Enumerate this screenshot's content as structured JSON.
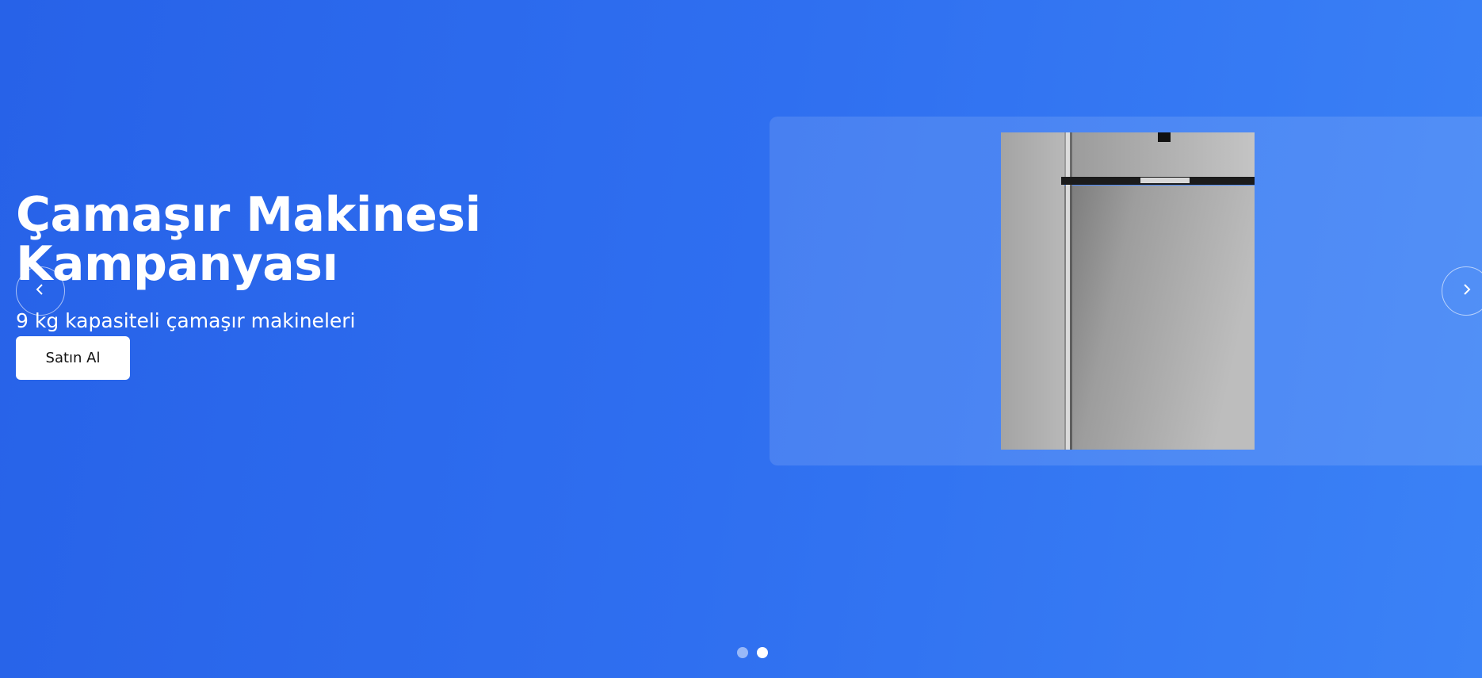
{
  "hero": {
    "title_line1": "Çamaşır Makinesi",
    "title_line2": "Kampanyası",
    "subtitle": "9 kg kapasiteli çamaşır makineleri",
    "cta_label": "Satın Al"
  },
  "carousel": {
    "prev_icon": "chevron-left-icon",
    "next_icon": "chevron-right-icon",
    "slide_count": 2,
    "active_slide": 2,
    "product_image": "refrigerator-photo"
  },
  "colors": {
    "background_start": "#2762e8",
    "background_end": "#3b82f6",
    "text": "#ffffff",
    "button_bg": "#ffffff",
    "button_text": "#111111"
  }
}
